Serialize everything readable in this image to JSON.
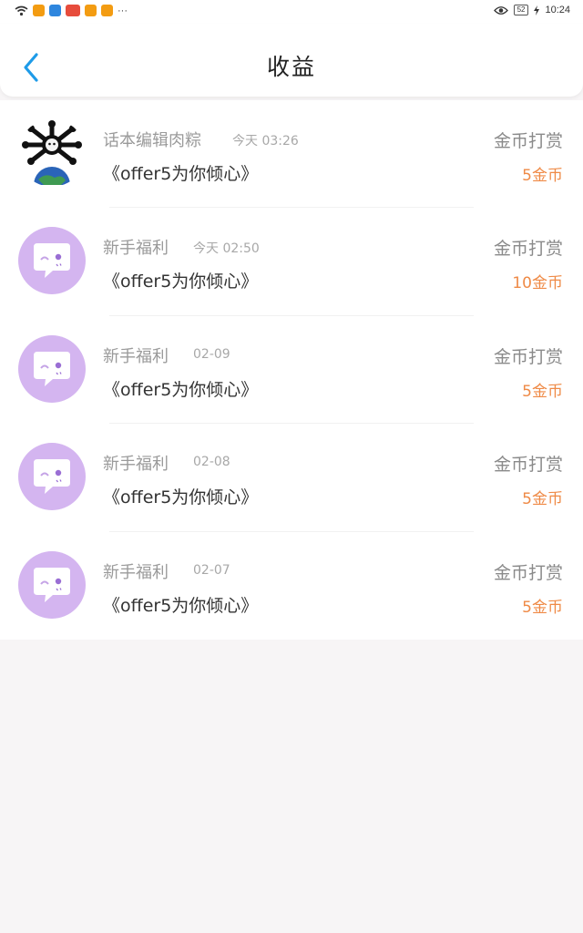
{
  "status_bar": {
    "time": "10:24",
    "battery": "52",
    "icon_colors": [
      "#f39c12",
      "#2e86de",
      "#e74c3c",
      "#f39c12",
      "#f39c12"
    ],
    "more": "···"
  },
  "header": {
    "title": "收益",
    "accent": "#1e9be8"
  },
  "records": [
    {
      "avatar": "spiky-ball-globe",
      "name": "话本编辑肉粽",
      "time": "今天 03:26",
      "book": "《offer5为你倾心》",
      "type": "金币打赏",
      "amount": "5金币"
    },
    {
      "avatar": "chat-bubble",
      "name": "新手福利",
      "time": "今天 02:50",
      "book": "《offer5为你倾心》",
      "type": "金币打赏",
      "amount": "10金币"
    },
    {
      "avatar": "chat-bubble",
      "name": "新手福利",
      "time": "02-09",
      "book": "《offer5为你倾心》",
      "type": "金币打赏",
      "amount": "5金币"
    },
    {
      "avatar": "chat-bubble",
      "name": "新手福利",
      "time": "02-08",
      "book": "《offer5为你倾心》",
      "type": "金币打赏",
      "amount": "5金币"
    },
    {
      "avatar": "chat-bubble",
      "name": "新手福利",
      "time": "02-07",
      "book": "《offer5为你倾心》",
      "type": "金币打赏",
      "amount": "5金币"
    }
  ],
  "colors": {
    "amount": "#ef8a46",
    "avatar_bg": "#d4b5f0",
    "page_bg": "#f7f5f6"
  }
}
